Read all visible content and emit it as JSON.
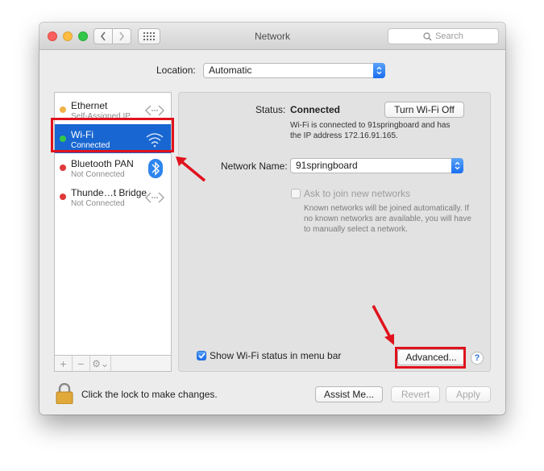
{
  "window": {
    "title": "Network"
  },
  "search": {
    "placeholder": "Search"
  },
  "location": {
    "label": "Location:",
    "value": "Automatic"
  },
  "services": [
    {
      "name": "Ethernet",
      "status": "Self-Assigned IP",
      "dot_color": "#f0b34a",
      "icon": "ethernet-icon"
    },
    {
      "name": "Wi-Fi",
      "status": "Connected",
      "dot_color": "#34c84a",
      "icon": "wifi-icon",
      "selected": true
    },
    {
      "name": "Bluetooth PAN",
      "status": "Not Connected",
      "dot_color": "#e0393a",
      "icon": "bluetooth-icon"
    },
    {
      "name": "Thunde…t Bridge",
      "status": "Not Connected",
      "dot_color": "#e0393a",
      "icon": "ethernet-icon"
    }
  ],
  "sidebar_controls": {
    "add": "+",
    "remove": "−",
    "gear": "⚙⌄"
  },
  "detail": {
    "status_label": "Status:",
    "status_value": "Connected",
    "turn_off_label": "Turn Wi-Fi Off",
    "status_description_1": "Wi-Fi is connected to 91springboard and has",
    "status_description_2": "the IP address 172.16.91.165.",
    "network_name_label": "Network Name:",
    "network_name_value": "91springboard",
    "ask_join_label": "Ask to join new networks",
    "ask_join_desc_1": "Known networks will be joined automatically. If",
    "ask_join_desc_2": "no known networks are available, you will have",
    "ask_join_desc_3": "to manually select a network.",
    "show_status_label": "Show Wi-Fi status in menu bar",
    "advanced_label": "Advanced...",
    "help_label": "?"
  },
  "footer": {
    "lock_text": "Click the lock to make changes.",
    "assist_label": "Assist Me...",
    "revert_label": "Revert",
    "apply_label": "Apply"
  },
  "accent_colors": {
    "selection": "#1866d1",
    "highlight": "#e0121d"
  }
}
